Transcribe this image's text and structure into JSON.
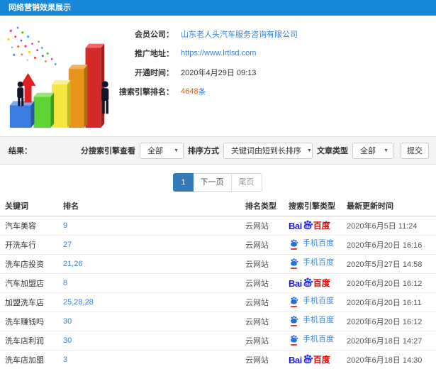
{
  "header": {
    "title": "网络营销效果展示"
  },
  "info": {
    "rows": [
      {
        "label": "会员公司：",
        "value": "山东老人头汽车服务咨询有限公司"
      },
      {
        "label": "推广地址：",
        "value": "https://www.lrtlsd.com"
      },
      {
        "label": "开通时间：",
        "value": "2020年4月29日 09:13"
      },
      {
        "label": "搜索引擎排名：",
        "value": "4648",
        "suffix": "条"
      }
    ]
  },
  "filters": {
    "result_label": "结果：",
    "engine_filter_label": "分搜索引擎查看",
    "engine_filter_value": "全部",
    "sort_label": "排序方式",
    "sort_value": "关键词由短到长排序",
    "article_type_label": "文章类型",
    "article_type_value": "全部",
    "submit_label": "提交"
  },
  "pagination": {
    "current": "1",
    "next": "下一页",
    "last": "尾页"
  },
  "table": {
    "columns": [
      "关键词",
      "排名",
      "排名类型",
      "搜索引擎类型",
      "最新更新时间"
    ],
    "baidu_logo": {
      "bai": "Bai",
      "du": "du",
      "cn": "百度"
    },
    "rows": [
      {
        "keyword": "汽车美容",
        "rank": "9",
        "rank_type": "云网站",
        "engine": "baidu",
        "engine_label": "百度",
        "updated": "2020年6月5日 11:24"
      },
      {
        "keyword": "开洗车行",
        "rank": "27",
        "rank_type": "云网站",
        "engine": "mobile",
        "engine_label": "手机百度",
        "updated": "2020年6月20日 16:16"
      },
      {
        "keyword": "洗车店投资",
        "rank": "21,26",
        "rank_type": "云网站",
        "engine": "mobile",
        "engine_label": "手机百度",
        "updated": "2020年5月27日 14:58"
      },
      {
        "keyword": "汽车加盟店",
        "rank": "8",
        "rank_type": "云网站",
        "engine": "baidu",
        "engine_label": "百度",
        "updated": "2020年6月20日 16:12"
      },
      {
        "keyword": "加盟洗车店",
        "rank": "25,28,28",
        "rank_type": "云网站",
        "engine": "mobile",
        "engine_label": "手机百度",
        "updated": "2020年6月20日 16:11"
      },
      {
        "keyword": "洗车赚钱吗",
        "rank": "30",
        "rank_type": "云网站",
        "engine": "mobile",
        "engine_label": "手机百度",
        "updated": "2020年6月20日 16:12"
      },
      {
        "keyword": "洗车店利润",
        "rank": "30",
        "rank_type": "云网站",
        "engine": "mobile",
        "engine_label": "手机百度",
        "updated": "2020年6月18日 14:27"
      },
      {
        "keyword": "洗车店加盟",
        "rank": "3",
        "rank_type": "云网站",
        "engine": "baidu",
        "engine_label": "百度",
        "updated": "2020年6月18日 14:30"
      }
    ]
  },
  "colors": {
    "topbar_blue": "#1787d8",
    "link_blue": "#3a7fd5",
    "count_red": "#ff5500",
    "active_page_blue": "#337ab7",
    "baidu_blue": "#2319dc",
    "baidu_red": "#e10601"
  }
}
